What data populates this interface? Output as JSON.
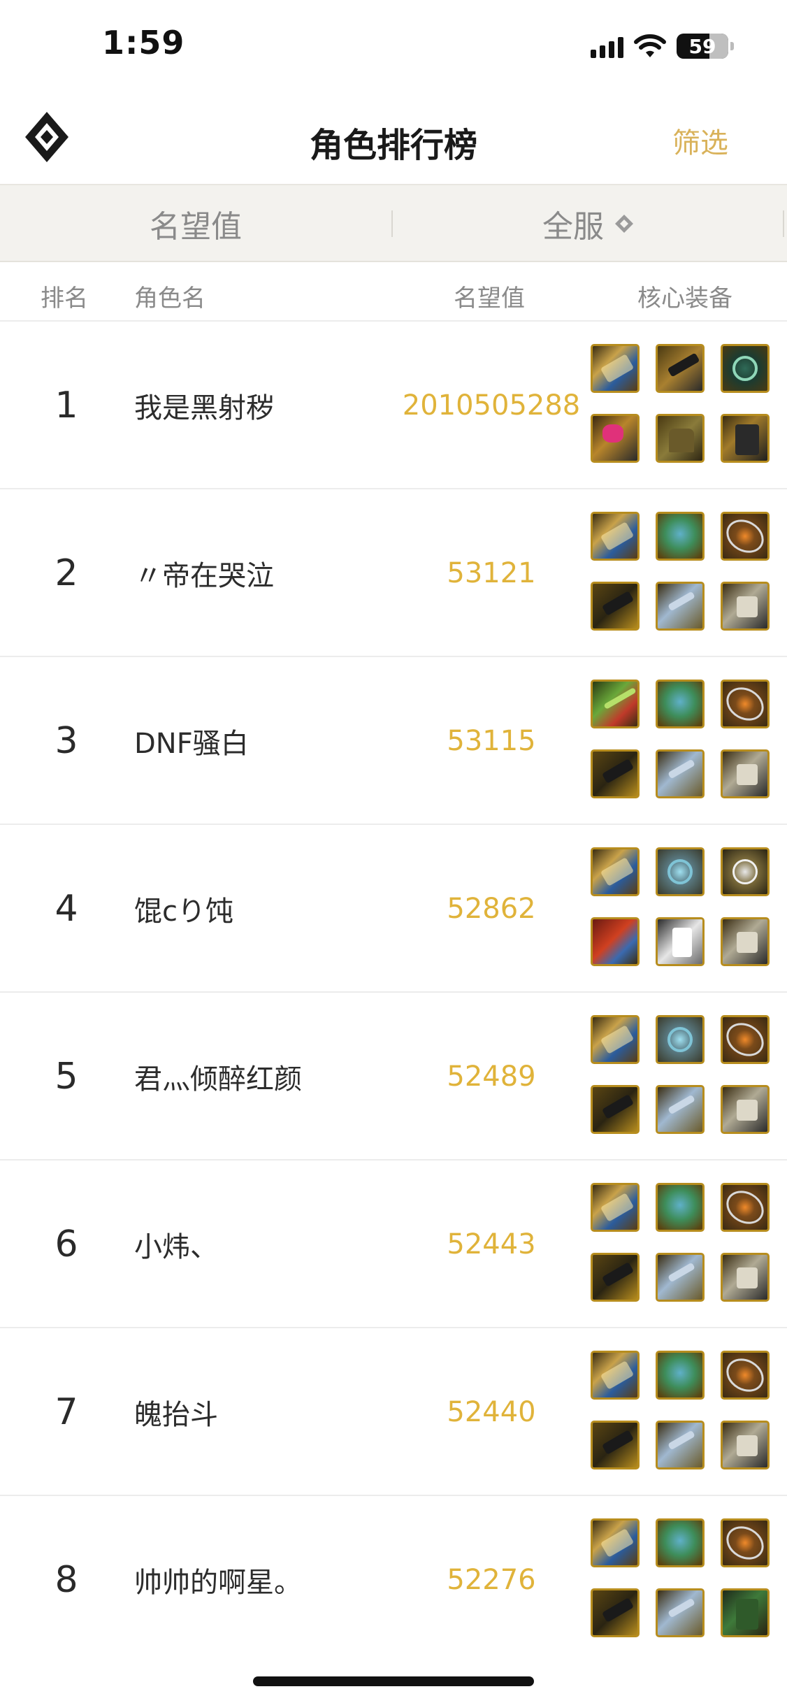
{
  "status_bar": {
    "time": "1:59",
    "battery": "59"
  },
  "header": {
    "title": "角色排行榜",
    "filter_label": "筛选"
  },
  "filters": {
    "left": "名望值",
    "right": "全服"
  },
  "columns": {
    "rank": "排名",
    "name": "角色名",
    "score": "名望值",
    "equipment": "核心装备"
  },
  "rows": [
    {
      "rank": "1",
      "name": "我是黑射秽",
      "score": "2010505288",
      "equipment": [
        "sword",
        "claw",
        "orb",
        "ring",
        "shoulder",
        "legs"
      ]
    },
    {
      "rank": "2",
      "name": "〃帝在哭泣",
      "score": "53121",
      "equipment": [
        "sword",
        "egg",
        "atom",
        "belt",
        "boots",
        "armor"
      ]
    },
    {
      "rank": "3",
      "name": "DNF骚白",
      "score": "53115",
      "equipment": [
        "greenblade",
        "egg",
        "atom",
        "belt",
        "boots",
        "armor"
      ]
    },
    {
      "rank": "4",
      "name": "馄cり饨",
      "score": "52862",
      "equipment": [
        "sword",
        "disc",
        "clock",
        "redgem",
        "robe",
        "armor"
      ]
    },
    {
      "rank": "5",
      "name": "君灬倾醉红颜",
      "score": "52489",
      "equipment": [
        "sword",
        "disc",
        "atom",
        "belt",
        "boots",
        "armor"
      ]
    },
    {
      "rank": "6",
      "name": "小炜、",
      "score": "52443",
      "equipment": [
        "sword",
        "egg",
        "atom",
        "belt",
        "boots",
        "armor"
      ]
    },
    {
      "rank": "7",
      "name": "魄抬斗",
      "score": "52440",
      "equipment": [
        "sword",
        "egg",
        "atom",
        "belt",
        "boots",
        "armor"
      ]
    },
    {
      "rank": "8",
      "name": "帅帅的啊星。",
      "score": "52276",
      "equipment": [
        "sword",
        "egg",
        "atom",
        "belt",
        "boots",
        "greenlegs"
      ]
    }
  ],
  "colors": {
    "accent": "#e0b33a",
    "filter_text": "#d9b25a",
    "filter_bg": "#f3f2ee"
  }
}
